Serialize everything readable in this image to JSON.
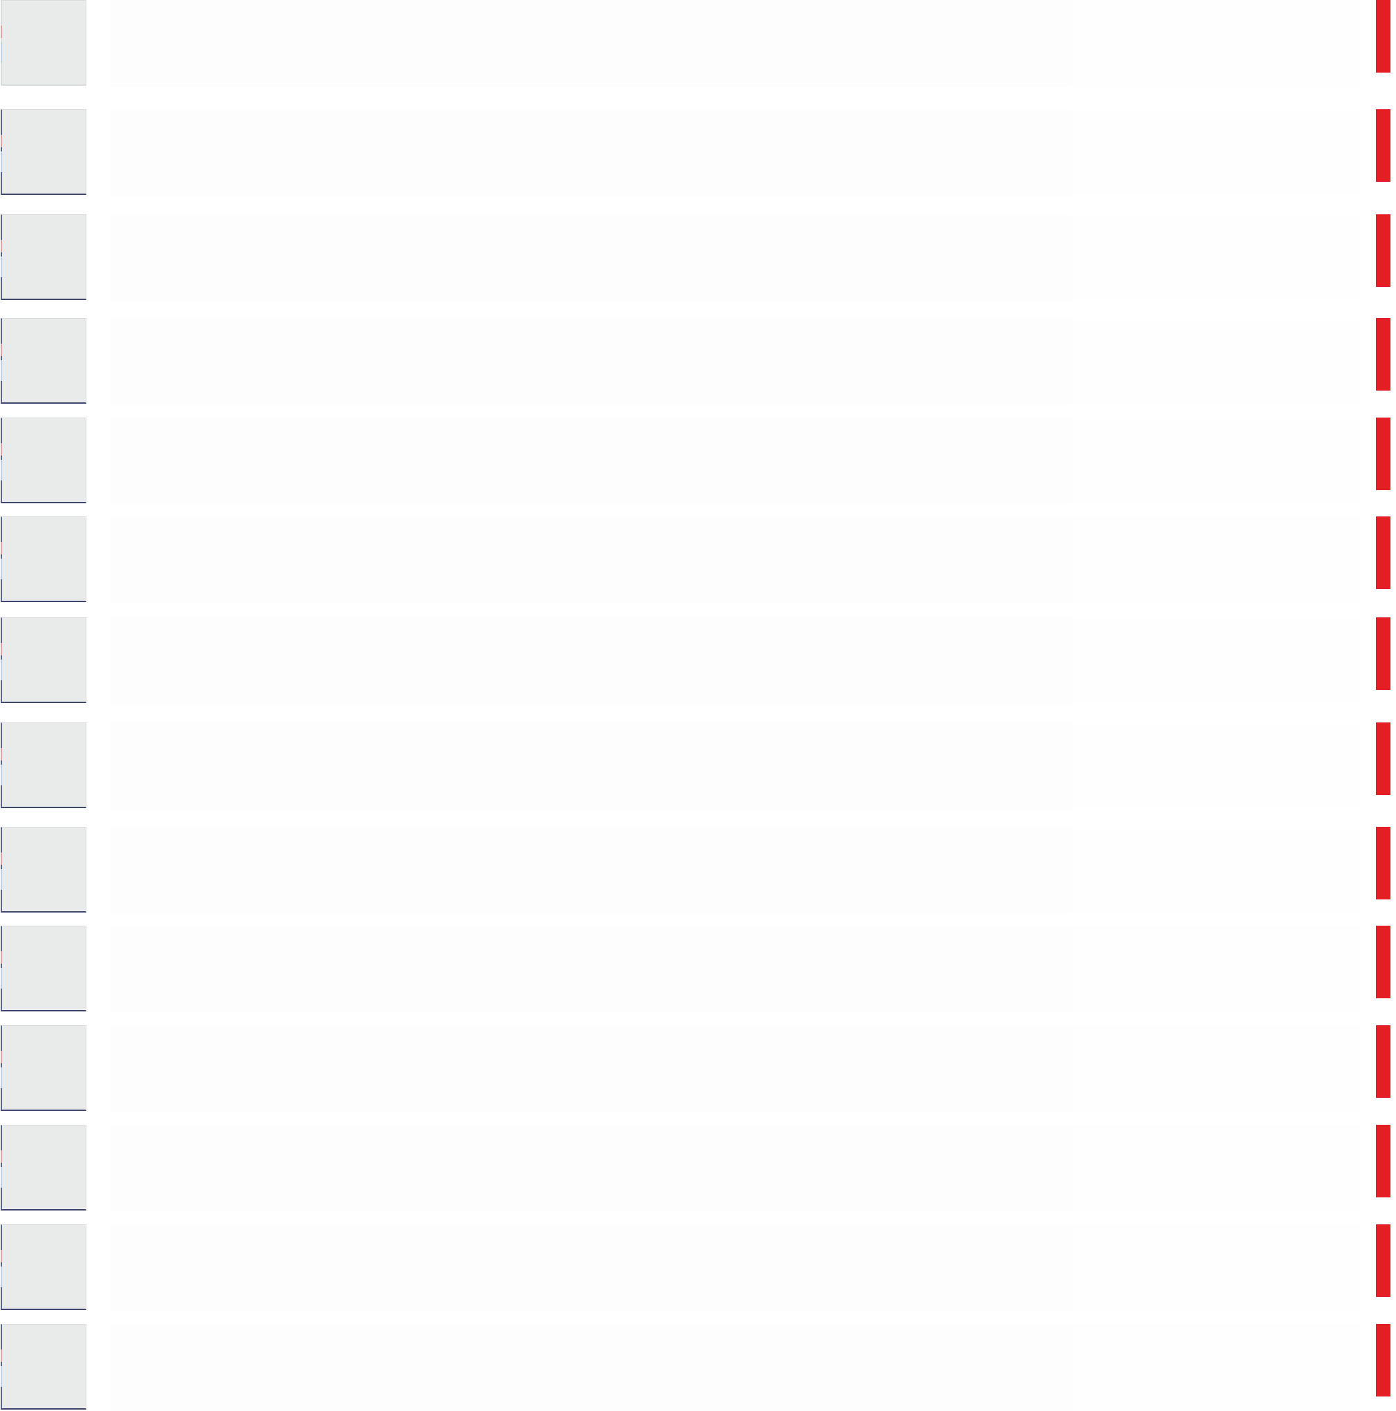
{
  "list": {
    "items": [
      {
        "id": 1
      },
      {
        "id": 2
      },
      {
        "id": 3
      },
      {
        "id": 4
      },
      {
        "id": 5
      },
      {
        "id": 6
      },
      {
        "id": 7
      },
      {
        "id": 8
      },
      {
        "id": 9
      },
      {
        "id": 10
      },
      {
        "id": 11
      },
      {
        "id": 12
      },
      {
        "id": 13
      },
      {
        "id": 14
      }
    ]
  },
  "colors": {
    "thumbnail_fill": "#e9ebeb",
    "thumbnail_border": "#3d4770",
    "edge_marker": "#e31e25",
    "background": "#ffffff"
  },
  "icons": {
    "thumbnail": "image-placeholder-icon",
    "edge_marker": "red-bar-marker-icon"
  }
}
